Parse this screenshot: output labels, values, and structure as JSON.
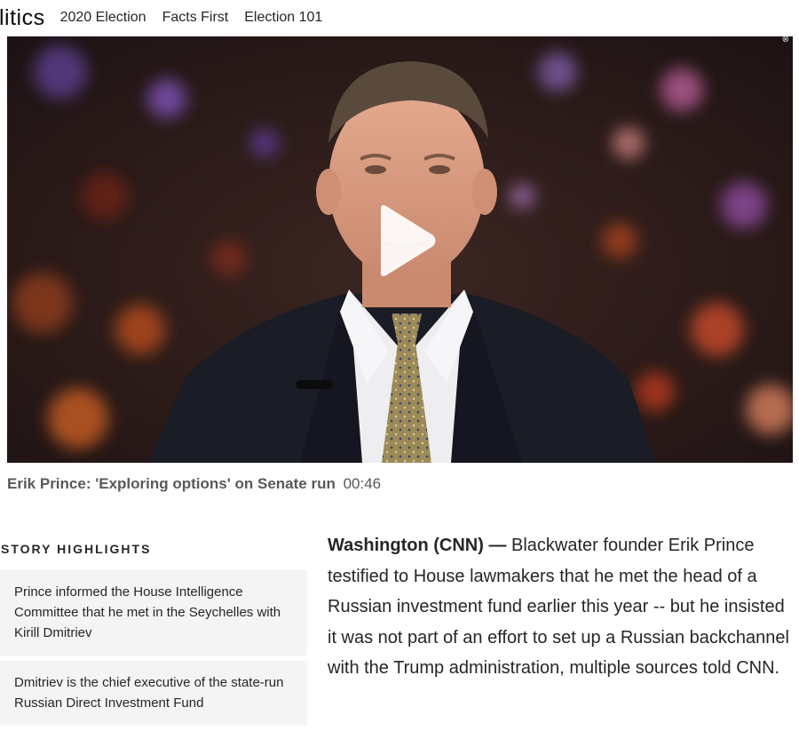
{
  "nav": {
    "logo_text": "litics",
    "links": [
      "2020 Election",
      "Facts First",
      "Election 101"
    ]
  },
  "video": {
    "title": "Erik Prince: 'Exploring options' on Senate run",
    "duration": "00:46",
    "corner_symbol": "⊗"
  },
  "highlights": {
    "heading": "STORY HIGHLIGHTS",
    "items": [
      "Prince informed the House Intelligence Committee that he met in the Seychelles with Kirill Dmitriev",
      "Dmitriev is the chief executive of the state-run Russian Direct Investment Fund"
    ]
  },
  "article": {
    "dateline": "Washington (CNN) —",
    "lead": "Blackwater founder Erik Prince testified to House lawmakers that he met the head of a Russian investment fund earlier this year -- but he insisted it was not part of an effort to set up a Russian backchannel with the Trump administration, multiple sources told CNN."
  },
  "colors": {
    "text": "#262626",
    "caption": "#595959",
    "highlight_bg": "#f4f4f4"
  }
}
